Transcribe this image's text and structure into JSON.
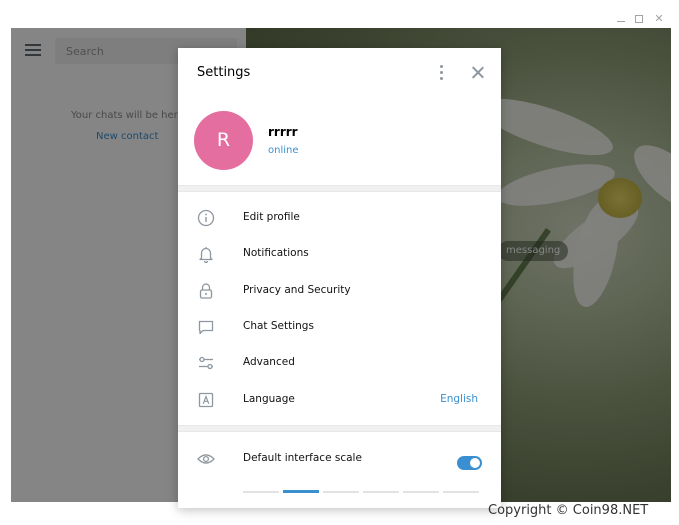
{
  "window": {
    "controls": [
      "minimize",
      "maximize",
      "close"
    ]
  },
  "sidebar": {
    "search_placeholder": "Search",
    "empty_text": "Your chats will be her",
    "new_contact": "New contact"
  },
  "chat_area": {
    "chip_text": "messaging"
  },
  "settings": {
    "title": "Settings",
    "profile": {
      "initial": "R",
      "name": "rrrrr",
      "status": "online",
      "avatar_color": "#e56ea0"
    },
    "items": [
      {
        "label": "Edit profile",
        "icon": "info-icon"
      },
      {
        "label": "Notifications",
        "icon": "bell-icon"
      },
      {
        "label": "Privacy and Security",
        "icon": "lock-icon"
      },
      {
        "label": "Chat Settings",
        "icon": "chat-bubble-icon"
      },
      {
        "label": "Advanced",
        "icon": "sliders-icon"
      },
      {
        "label": "Language",
        "icon": "language-icon",
        "value": "English"
      }
    ],
    "scale": {
      "label": "Default interface scale",
      "enabled": true,
      "steps": 6,
      "selected_step": 2
    }
  },
  "colors": {
    "accent": "#3a8fd0",
    "overlay": "rgba(0,0,0,0.48)"
  },
  "footer": {
    "copyright": "Copyright © Coin98.NET"
  }
}
